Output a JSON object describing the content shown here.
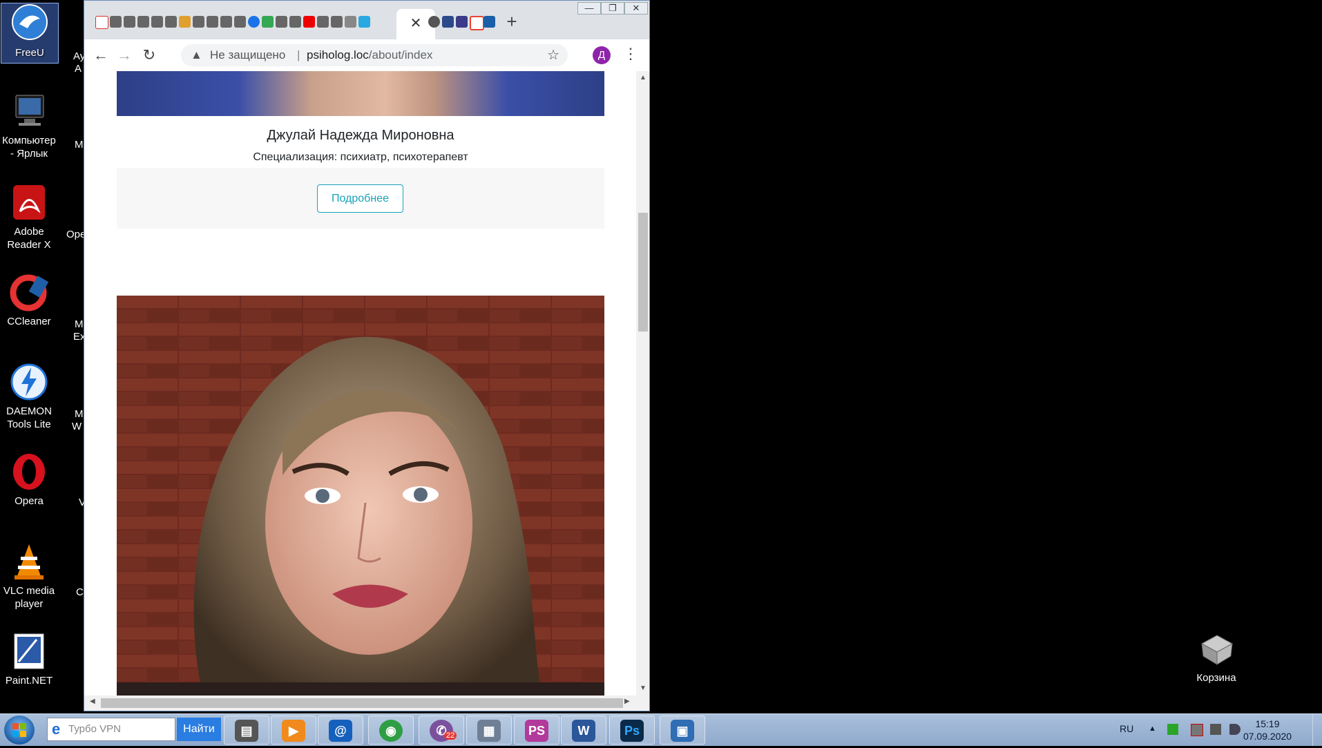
{
  "desktop": {
    "icons": [
      {
        "label": "FreeU",
        "color": "#2f7fd6",
        "glyph": "swallow"
      },
      {
        "label": "Компьютер - Ярлык",
        "color": "#3c3c3c",
        "glyph": "monitor"
      },
      {
        "label": "Adobe Reader X",
        "color": "#c81414",
        "glyph": "pdf"
      },
      {
        "label": "CCleaner",
        "color": "#d33",
        "glyph": "broom"
      },
      {
        "label": "DAEMON Tools Lite",
        "color": "#1e73d8",
        "glyph": "lightning"
      },
      {
        "label": "Opera",
        "color": "#d8111e",
        "glyph": "opera"
      },
      {
        "label": "VLC media player",
        "color": "#f28a00",
        "glyph": "cone"
      },
      {
        "label": "Paint.NET",
        "color": "#3a6ab8",
        "glyph": "paint"
      }
    ],
    "partial_labels": [
      "Ay",
      "A",
      "M",
      "Ope",
      "M",
      "Ex",
      "M",
      "W",
      "V",
      "C"
    ],
    "recycle_bin": "Корзина"
  },
  "browser": {
    "active_tab_close": "✕",
    "new_tab": "+",
    "window_buttons": [
      "—",
      "❐",
      "✕"
    ],
    "nav": {
      "back": "←",
      "forward": "→",
      "reload": "↻"
    },
    "omnibox": {
      "security_icon": "▲",
      "security_text": "Не защищено",
      "separator": "|",
      "host": "psiholog.loc",
      "path": "/about/index",
      "bookmark_icon": "☆"
    },
    "profile_initial": "Д",
    "menu": "⋮"
  },
  "page": {
    "doctor": {
      "name": "Джулай Надежда Мироновна",
      "specialization": "Специализация: психиатр, психотерапевт",
      "more_button": "Подробнее"
    }
  },
  "taskbar": {
    "search_placeholder": "Турбо VPN",
    "search_button": "Найти",
    "apps": [
      {
        "name": "file-manager",
        "color": "#555555",
        "glyph": "▤"
      },
      {
        "name": "media-player",
        "color": "#f08a1c",
        "glyph": "▶"
      },
      {
        "name": "mail-ru",
        "color": "#1560bd",
        "glyph": "@"
      },
      {
        "name": "chrome",
        "color": "#2e9e44",
        "glyph": "◉"
      },
      {
        "name": "viber",
        "color": "#7b519d",
        "glyph": "✆",
        "badge": "22"
      },
      {
        "name": "calculator",
        "color": "#6f7f95",
        "glyph": "▦"
      },
      {
        "name": "phpstorm",
        "color": "#b23a9b",
        "glyph": "PS"
      },
      {
        "name": "word",
        "color": "#2b579a",
        "glyph": "W"
      },
      {
        "name": "photoshop",
        "color": "#0b2a4a",
        "glyph": "Ps"
      },
      {
        "name": "image-viewer",
        "color": "#2f6db4",
        "glyph": "▣"
      }
    ],
    "language": "RU",
    "tray_arrow": "▲",
    "time": "15:19",
    "date": "07.09.2020"
  }
}
